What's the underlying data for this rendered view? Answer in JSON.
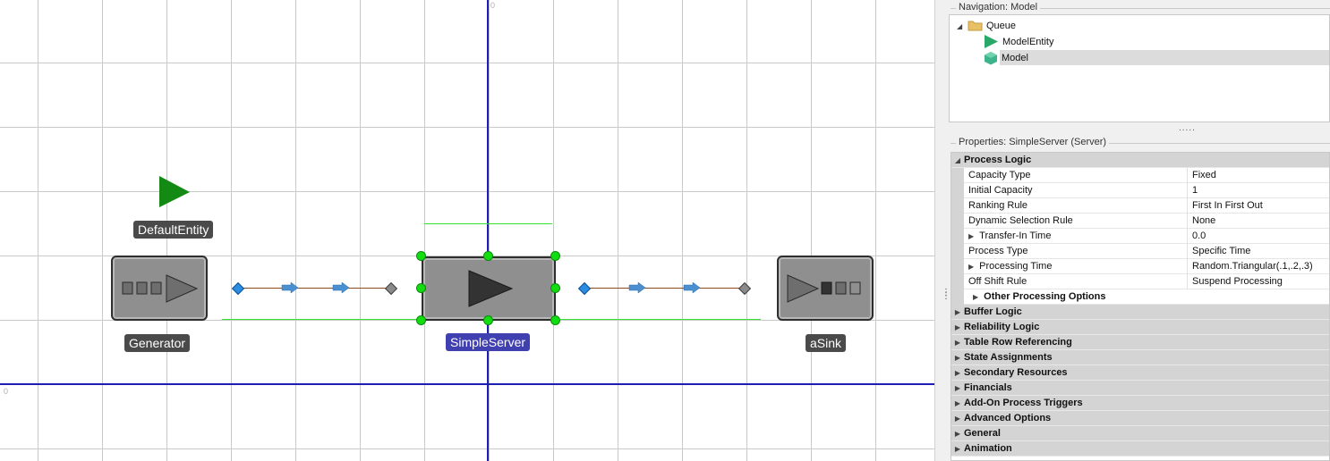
{
  "canvas": {
    "axis_origin_x_label": "0",
    "axis_origin_y_label": "0",
    "objects": {
      "default_entity": {
        "label": "DefaultEntity",
        "color": "#138a13"
      },
      "generator": {
        "label": "Generator"
      },
      "simple_server": {
        "label": "SimpleServer",
        "selected": true
      },
      "sink": {
        "label": "aSink"
      }
    },
    "colors": {
      "axis": "#1e1eb4",
      "selection": "#11dd11",
      "path": "#8b4a1e",
      "input_node": "#2a8de0"
    }
  },
  "navigation": {
    "title": "Navigation: Model",
    "items": [
      {
        "label": "Queue",
        "icon": "folder-icon",
        "expanded": true
      },
      {
        "label": "ModelEntity",
        "icon": "entity-triangle-icon"
      },
      {
        "label": "Model",
        "icon": "model-cube-icon",
        "selected": true
      }
    ]
  },
  "splitter_grip": ".....",
  "properties": {
    "title": "Properties: SimpleServer (Server)",
    "process_logic": {
      "label": "Process Logic",
      "rows": [
        {
          "name": "Capacity Type",
          "value": "Fixed"
        },
        {
          "name": "Initial Capacity",
          "value": "1"
        },
        {
          "name": "Ranking Rule",
          "value": "First In First Out"
        },
        {
          "name": "Dynamic Selection Rule",
          "value": "None"
        },
        {
          "name": "Transfer-In Time",
          "value": "0.0",
          "expandable": true
        },
        {
          "name": "Process Type",
          "value": "Specific Time"
        },
        {
          "name": "Processing Time",
          "value": "Random.Triangular(.1,.2,.3)",
          "expandable": true
        },
        {
          "name": "Off Shift Rule",
          "value": "Suspend Processing"
        }
      ],
      "sub_category": "Other Processing Options"
    },
    "categories": [
      "Buffer Logic",
      "Reliability Logic",
      "Table Row Referencing",
      "State Assignments",
      "Secondary Resources",
      "Financials",
      "Add-On Process Triggers",
      "Advanced Options",
      "General",
      "Animation"
    ]
  }
}
